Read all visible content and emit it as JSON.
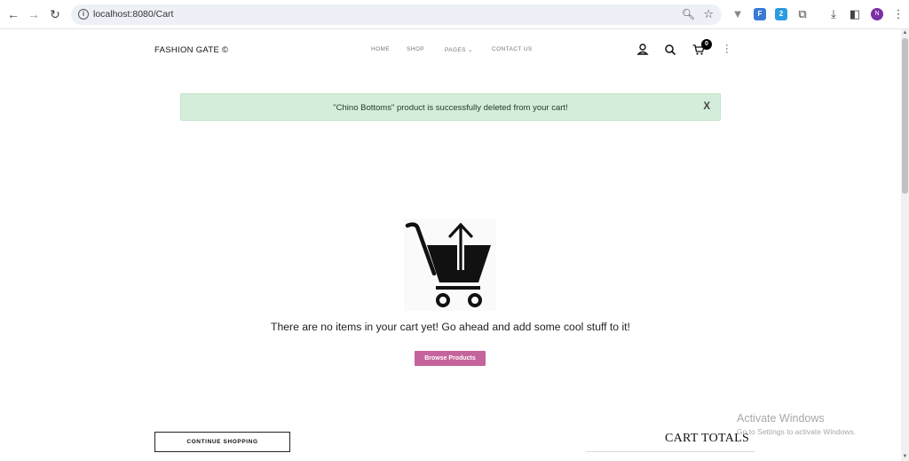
{
  "browser": {
    "url": "localhost:8080/Cart",
    "profile_initial": "N",
    "ext1_label": "F",
    "ext2_label": "2"
  },
  "header": {
    "brand": "FASHION GATE ©",
    "nav": [
      "HOME",
      "SHOP",
      "PAGES",
      "CONTACT US"
    ],
    "cart_count": "0"
  },
  "alert": {
    "message": "\"Chino Bottoms\" product is successfully deleted from your cart!",
    "close_label": "X"
  },
  "empty_cart": {
    "message": "There are no items in your cart yet! Go ahead and add some cool stuff to it!",
    "browse_button": "Browse Products"
  },
  "footer": {
    "continue_button": "CONTINUE SHOPPING",
    "totals_title": "CART TOTALS"
  },
  "watermark": {
    "line1": "Activate Windows",
    "line2": "Go to Settings to activate Windows."
  },
  "colors": {
    "alert_bg": "#d4edda",
    "browse_button": "#c5649c",
    "profile": "#7b2fa7"
  }
}
